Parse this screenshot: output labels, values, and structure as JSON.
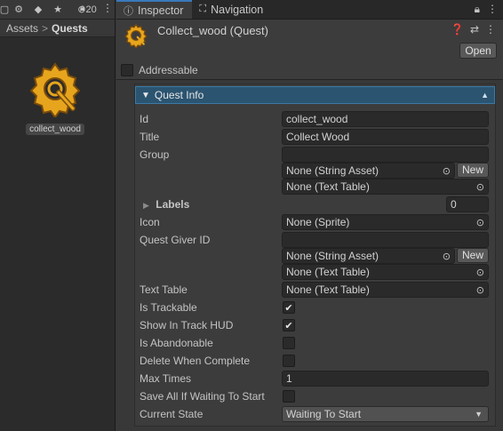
{
  "project": {
    "toolbar": {
      "hidden_count": "20"
    },
    "breadcrumb": {
      "root": "Assets",
      "separator": ">",
      "current": "Quests"
    },
    "asset": {
      "name": "collect_wood"
    }
  },
  "inspector": {
    "tabs": [
      {
        "label": "Inspector",
        "icon": "info-icon"
      },
      {
        "label": "Navigation",
        "icon": "navigation-icon"
      }
    ],
    "header": {
      "title": "Collect_wood (Quest)",
      "open_label": "Open"
    },
    "addressable_label": "Addressable",
    "section_title": "Quest Info",
    "fields": {
      "id": {
        "label": "Id",
        "value": "collect_wood"
      },
      "title": {
        "label": "Title",
        "value": "Collect Wood"
      },
      "group": {
        "label": "Group",
        "value": "",
        "string_asset": "None (String Asset)",
        "new_label": "New",
        "text_table": "None (Text Table)"
      },
      "labels": {
        "label": "Labels",
        "count": "0"
      },
      "icon": {
        "label": "Icon",
        "value": "None (Sprite)"
      },
      "quest_giver": {
        "label": "Quest Giver ID",
        "value": "",
        "string_asset": "None (String Asset)",
        "new_label": "New",
        "text_table": "None (Text Table)"
      },
      "text_table": {
        "label": "Text Table",
        "value": "None (Text Table)"
      },
      "is_trackable": {
        "label": "Is Trackable",
        "checked": true
      },
      "show_in_hud": {
        "label": "Show In Track HUD",
        "checked": true
      },
      "is_abandonable": {
        "label": "Is Abandonable",
        "checked": false
      },
      "delete_when_complete": {
        "label": "Delete When Complete",
        "checked": false
      },
      "max_times": {
        "label": "Max Times",
        "value": "1"
      },
      "save_all": {
        "label": "Save All If Waiting To Start",
        "checked": false
      },
      "current_state": {
        "label": "Current State",
        "value": "Waiting To Start"
      }
    }
  },
  "colors": {
    "section_header": "#2b5470",
    "quest_icon": "#e6a51d",
    "tab_accent": "#3a79bb"
  }
}
